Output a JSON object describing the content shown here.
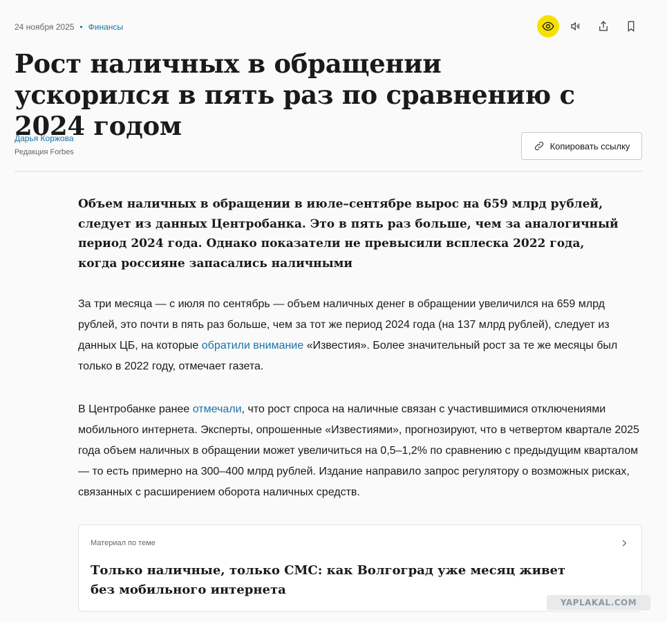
{
  "meta": {
    "date": "24 ноября 2025",
    "separator": "•",
    "rubric": "Финансы"
  },
  "toolbar": {
    "items": [
      {
        "name": "eye-icon",
        "accent": "#f5e100"
      },
      {
        "name": "speaker-icon"
      },
      {
        "name": "share-icon"
      },
      {
        "name": "bookmark-icon"
      }
    ]
  },
  "article": {
    "headline": "Рост наличных в обращении ускорился в пять раз по сравнению с 2024 годом",
    "author": {
      "name": "Дарья Коржова",
      "role": "Редакция Forbes"
    },
    "copy_link_label": "Копировать ссылку",
    "lead": "Объем наличных в обращении в июле–сентябре вырос на 659 млрд рублей, следует из данных Центробанка. Это в пять раз больше, чем за аналогичный период 2024 года. Однако показатели не превысили всплеска 2022 года, когда россияне запасались наличными",
    "para1": {
      "before": "За три месяца — с июля по сентябрь — объем наличных денег в обращении увеличился на 659 млрд рублей, это почти в пять раз больше, чем за тот же период 2024 года (на 137 млрд рублей), следует из данных ЦБ, на которые ",
      "link": "обратили внимание",
      "after": " «Известия». Более значительный рост за те же месяцы был только в 2022 году, отмечает газета."
    },
    "para2": {
      "before": "В Центробанке ранее ",
      "link": "отмечали",
      "after": ", что рост спроса на наличные связан с участившимися отключениями мобильного интернета. Эксперты, опрошенные «Известиями», прогнозируют, что в четвертом квартале 2025 года объем наличных в обращении может увеличиться на 0,5–1,2% по сравнению с предыдущим кварталом — то есть примерно на 300–400 млрд рублей. Издание направило запрос регулятору о возможных рисках, связанных с расширением оборота наличных средств."
    },
    "related": {
      "label": "Материал по теме",
      "title": "Только наличные, только СМС: как Волгоград уже месяц живет без мобильного интернета"
    }
  },
  "watermark": "YAPLAKAL.COM",
  "colors": {
    "link": "#1a73a8",
    "accent": "#f5e100"
  }
}
